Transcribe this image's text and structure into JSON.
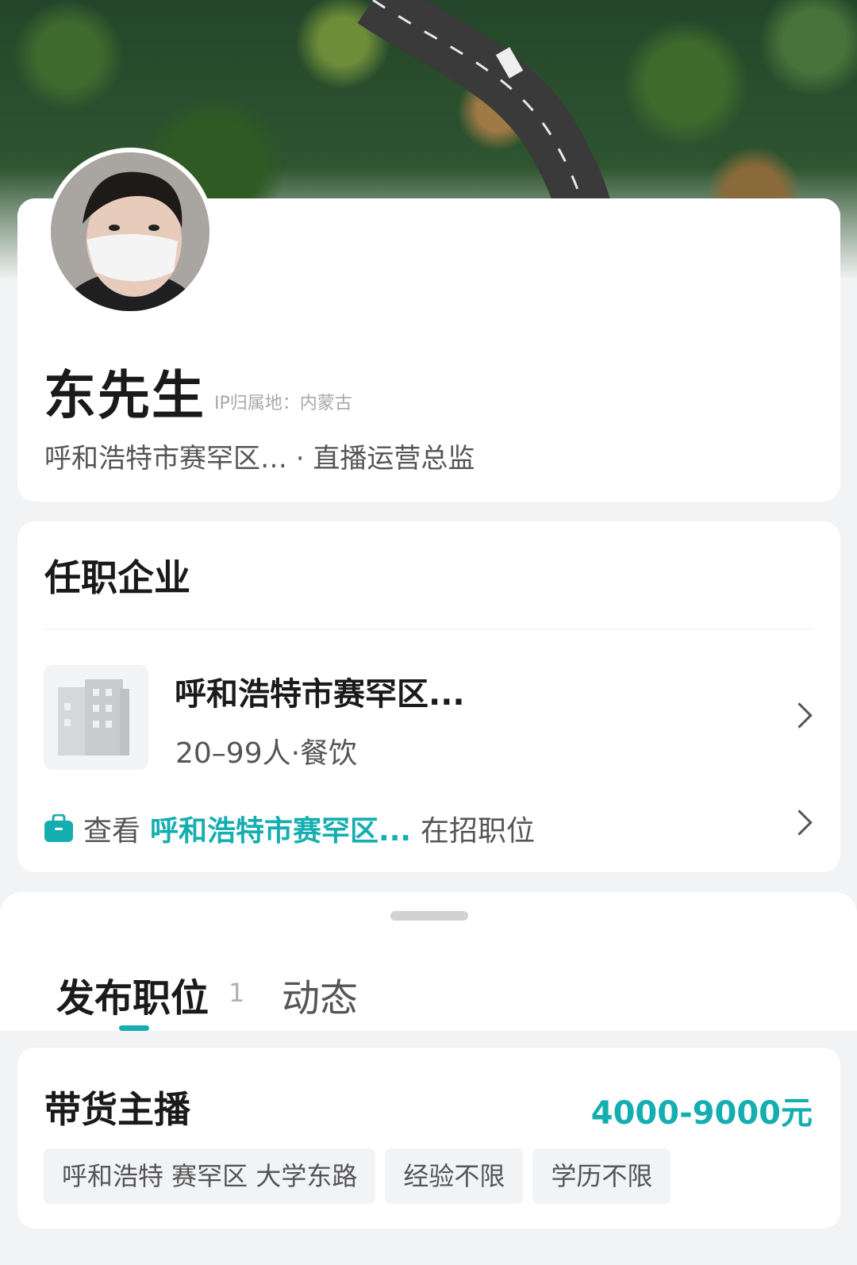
{
  "profile": {
    "name": "东先生",
    "ip_location": "IP归属地：内蒙古",
    "subline": "呼和浩特市赛罕区… · 直播运营总监"
  },
  "company_section": {
    "title": "任职企业",
    "company_name": "呼和浩特市赛罕区...",
    "company_meta": "20–99人·餐饮",
    "jobs_link": {
      "prefix": "查看",
      "company": "呼和浩特市赛罕区...",
      "suffix": "在招职位"
    }
  },
  "tabs": [
    {
      "label": "发布职位",
      "count": "1",
      "active": true
    },
    {
      "label": "动态",
      "active": false
    }
  ],
  "job": {
    "title": "带货主播",
    "salary": "4000-9000元",
    "tags": [
      "呼和浩特 赛罕区 大学东路",
      "经验不限",
      "学历不限"
    ]
  },
  "colors": {
    "accent": "#15aeb0"
  },
  "icons": [
    "avatar",
    "building-icon",
    "chevron-right-icon",
    "briefcase-icon"
  ]
}
